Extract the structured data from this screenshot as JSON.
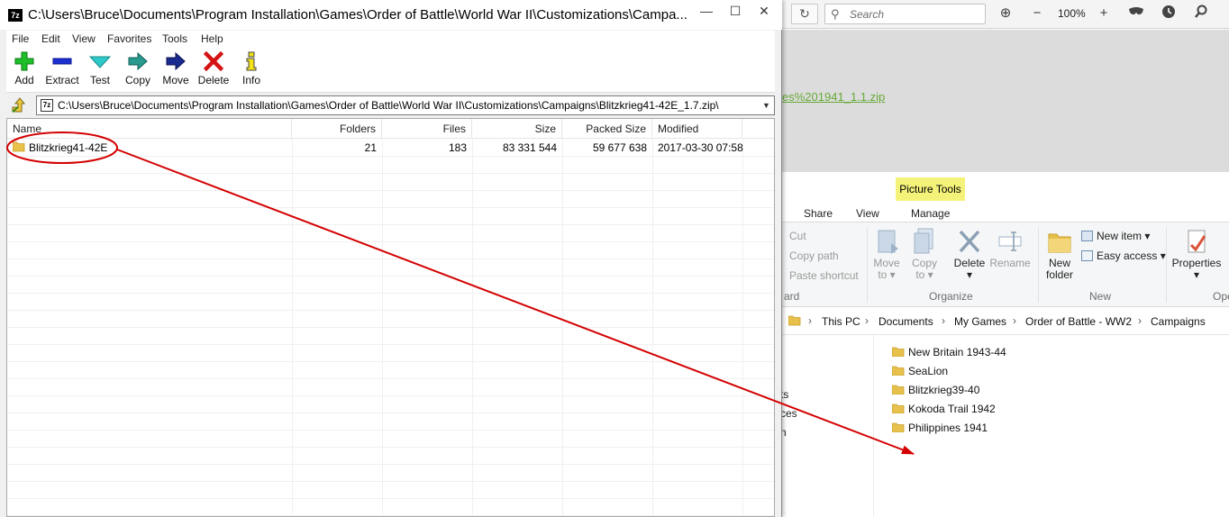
{
  "browser": {
    "search_placeholder": "Search",
    "zoom_level": "100%",
    "link_text": "es%201941_1.1.zip"
  },
  "explorer": {
    "contextual_tab": "Picture Tools",
    "tabs": [
      "Share",
      "View",
      "Manage"
    ],
    "clipboard": {
      "cut": "Cut",
      "copy_path": "Copy path",
      "paste_shortcut": "Paste shortcut",
      "group_fragment": "ard"
    },
    "organize": {
      "move_to": "Move to",
      "move_to_arrow": "to ▾",
      "move_top": "Move",
      "copy_top": "Copy",
      "copy_arrow": "to ▾",
      "delete": "Delete",
      "delete_arrow": "▾",
      "rename": "Rename",
      "group": "Organize"
    },
    "new": {
      "new_folder_1": "New",
      "new_folder_2": "folder",
      "new_item": "New item ▾",
      "easy_access": "Easy access ▾",
      "group": "New"
    },
    "open": {
      "properties": "Properties",
      "properties_arrow": "▾",
      "group_fragment": "Ope"
    },
    "breadcrumb": [
      "This PC",
      "Documents",
      "My Games",
      "Order of Battle - WW2",
      "Campaigns"
    ],
    "nav_fragments": [
      "ts",
      "ces",
      "n"
    ],
    "folders": [
      "New Britain 1943-44",
      "SeaLion",
      "Blitzkrieg39-40",
      "Kokoda Trail 1942",
      "Philippines 1941"
    ]
  },
  "zip": {
    "app_icon_text": "7z",
    "title": "C:\\Users\\Bruce\\Documents\\Program Installation\\Games\\Order of Battle\\World War II\\Customizations\\Campa...",
    "menu": [
      "File",
      "Edit",
      "View",
      "Favorites",
      "Tools",
      "Help"
    ],
    "toolbar": {
      "add": "Add",
      "extract": "Extract",
      "test": "Test",
      "copy": "Copy",
      "move": "Move",
      "delete": "Delete",
      "info": "Info"
    },
    "path": "C:\\Users\\Bruce\\Documents\\Program Installation\\Games\\Order of Battle\\World War II\\Customizations\\Campaigns\\Blitzkrieg41-42E_1.7.zip\\",
    "path_icon_text": "7z",
    "columns": {
      "name": "Name",
      "folders": "Folders",
      "files": "Files",
      "size": "Size",
      "packed": "Packed Size",
      "modified": "Modified"
    },
    "rows": [
      {
        "name": "Blitzkrieg41-42E",
        "folders": "21",
        "files": "183",
        "size": "83 331 544",
        "packed": "59 677 638",
        "modified": "2017-03-30 07:58"
      }
    ]
  },
  "colors": {
    "annotation_red": "#d40000",
    "folder_yellow": "#e8c14d",
    "picture_tools": "#f5f27a",
    "link_green": "#65a936"
  }
}
